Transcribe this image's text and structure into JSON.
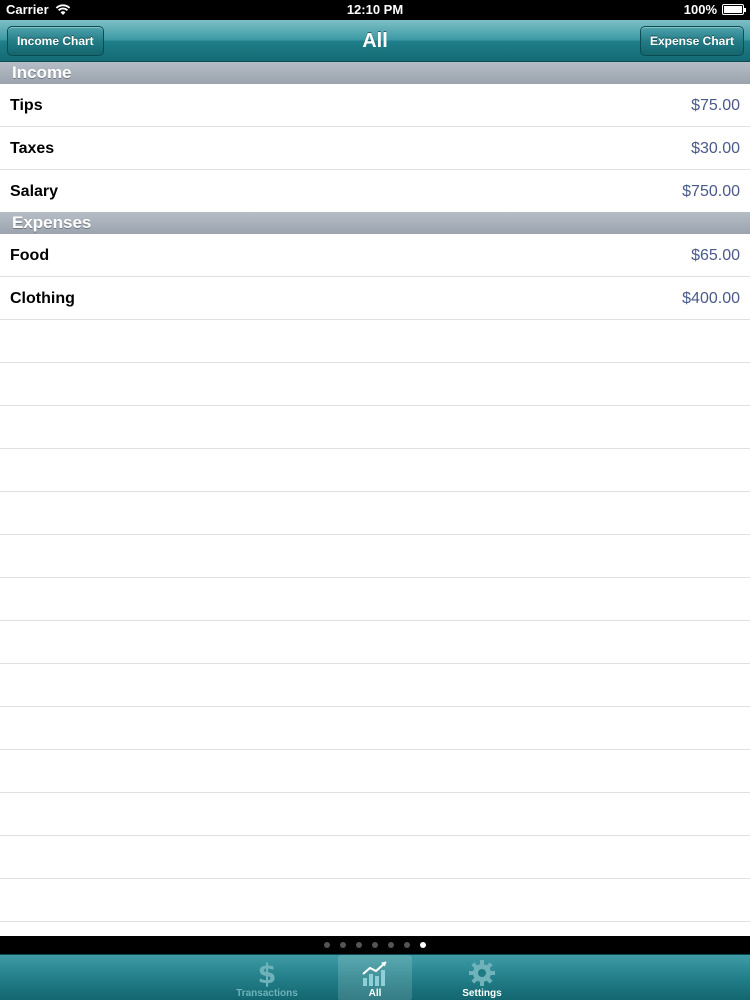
{
  "status_bar": {
    "carrier": "Carrier",
    "time": "12:10 PM",
    "battery": "100%",
    "battery_level": 1.0,
    "wifi_icon": "wifi-icon"
  },
  "nav_bar": {
    "title": "All",
    "left_button": "Income Chart",
    "right_button": "Expense Chart"
  },
  "sections": {
    "income": {
      "title": "Income",
      "rows": [
        {
          "label": "Tips",
          "value": "$75.00"
        },
        {
          "label": "Taxes",
          "value": "$30.00"
        },
        {
          "label": "Salary",
          "value": "$750.00"
        }
      ]
    },
    "expenses": {
      "title": "Expenses",
      "rows": [
        {
          "label": "Food",
          "value": "$65.00"
        },
        {
          "label": "Clothing",
          "value": "$400.00"
        }
      ]
    }
  },
  "page_control": {
    "count": 7,
    "current": 7
  },
  "tab_bar": {
    "tabs": [
      {
        "label": "Transactions",
        "icon": "dollar-icon",
        "selected": false
      },
      {
        "label": "All",
        "icon": "chart-icon",
        "selected": true
      },
      {
        "label": "Settings",
        "icon": "gear-icon",
        "selected": false
      }
    ]
  },
  "colors": {
    "nav_teal": "#237d87",
    "amount_text": "#4a5a8a",
    "section_header": "#a8b0ba"
  }
}
